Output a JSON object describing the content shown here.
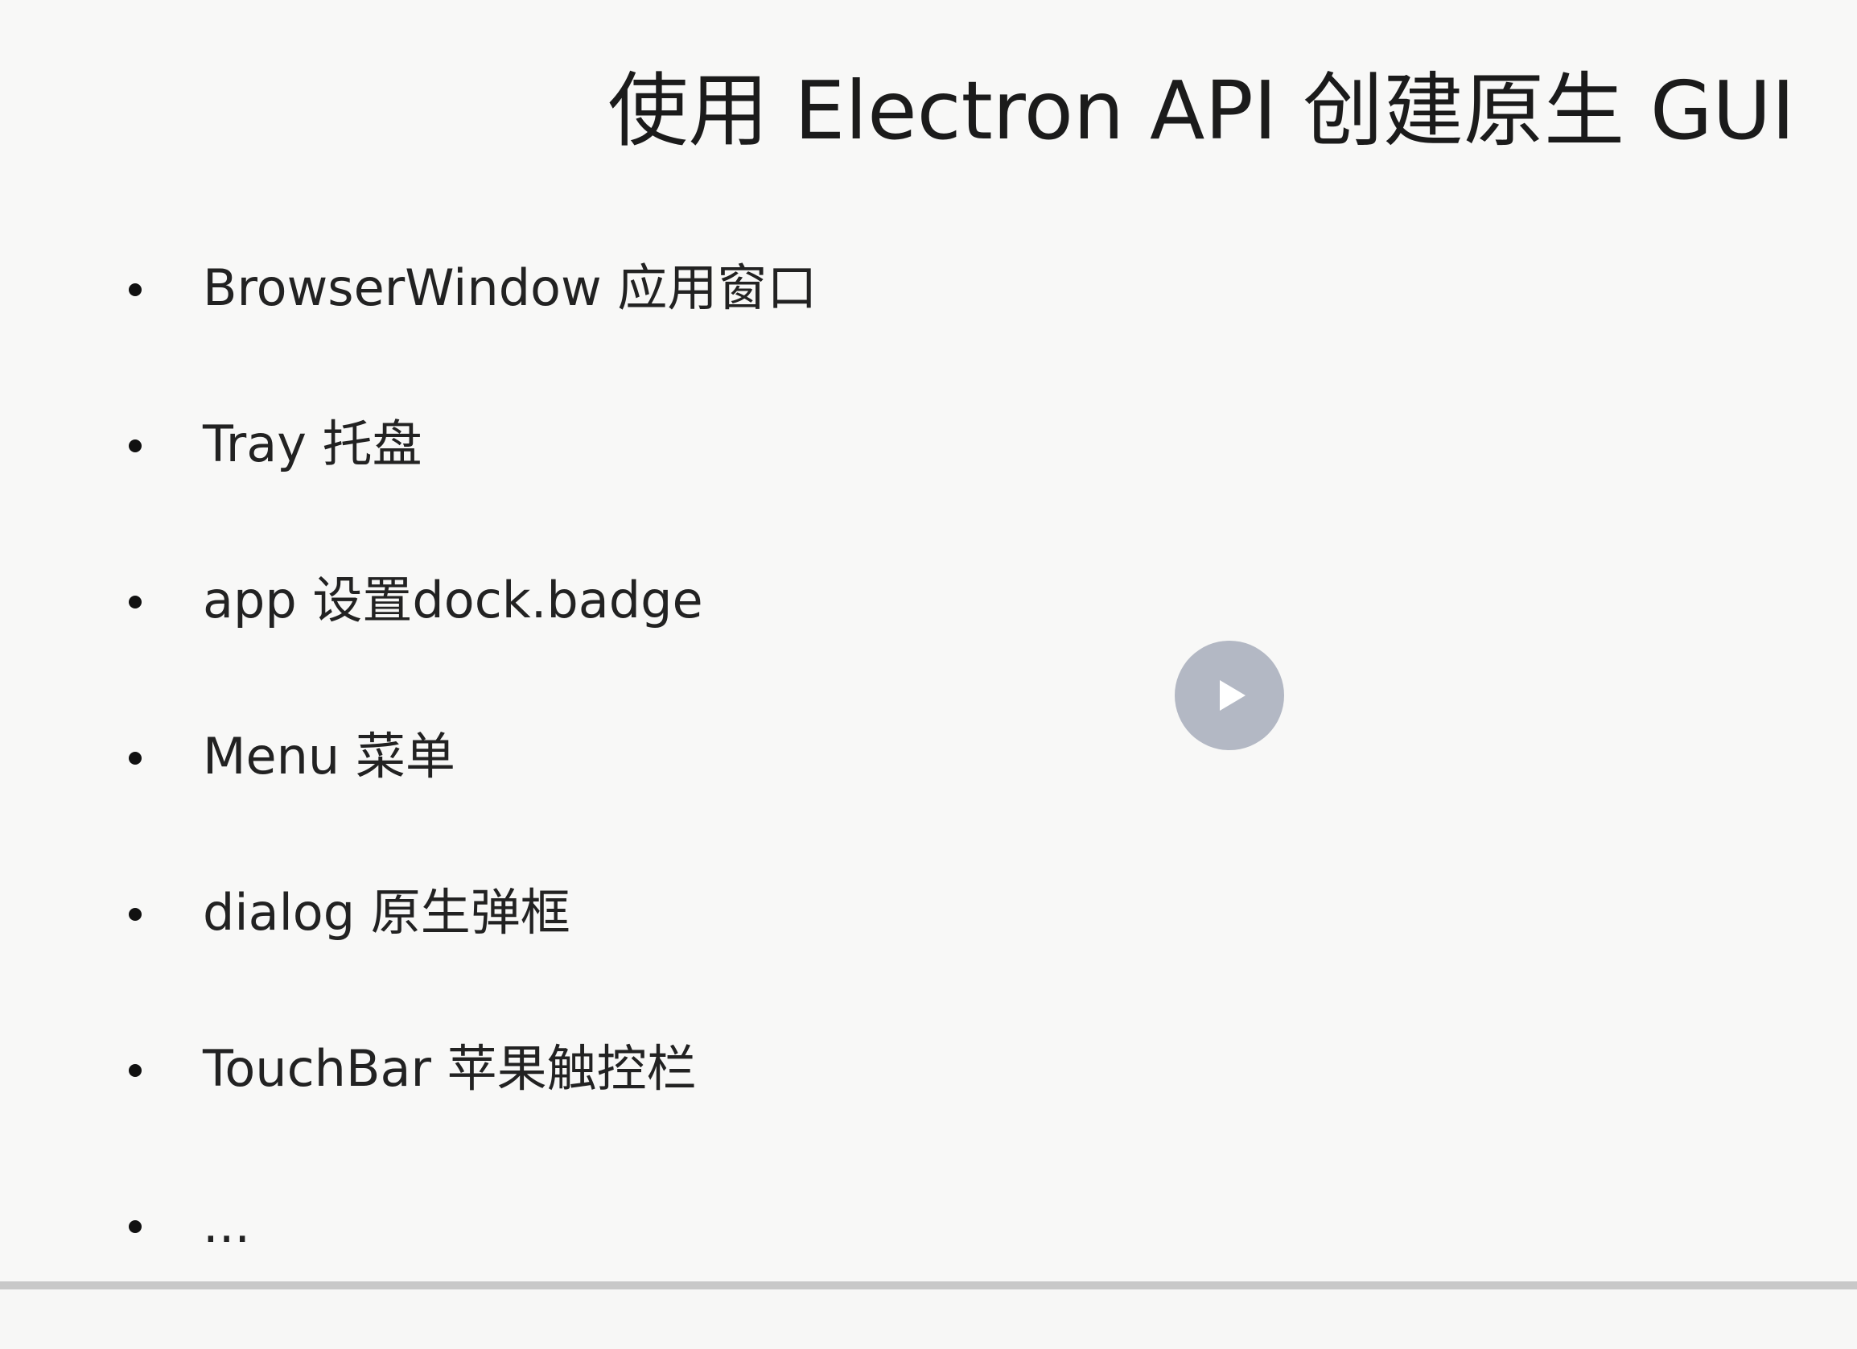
{
  "slide": {
    "title": "使用 Electron API 创建原生 GUI",
    "items": [
      {
        "text": "BrowserWindow 应用窗口"
      },
      {
        "text": "Tray  托盘"
      },
      {
        "text": "app 设置dock.badge"
      },
      {
        "text": "Menu 菜单"
      },
      {
        "text": "dialog 原生弹框"
      },
      {
        "text": "TouchBar 苹果触控栏"
      },
      {
        "text": "..."
      }
    ]
  },
  "player": {
    "play_icon": "play-icon",
    "button_color": "#b3b8c4"
  }
}
